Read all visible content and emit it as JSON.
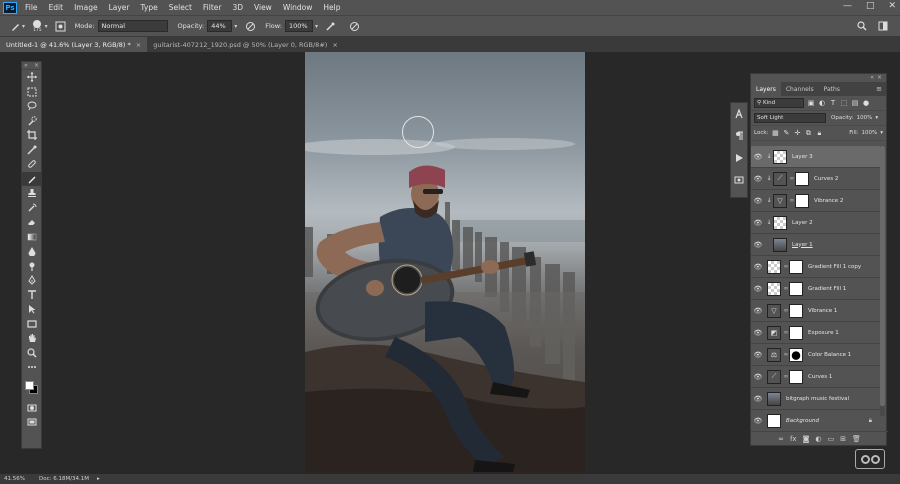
{
  "app": {
    "logo": "Ps"
  },
  "menu": [
    "File",
    "Edit",
    "Image",
    "Layer",
    "Type",
    "Select",
    "Filter",
    "3D",
    "View",
    "Window",
    "Help"
  ],
  "window_controls": {
    "minimize": "—",
    "maximize": "□",
    "close": "✕"
  },
  "options": {
    "brush_size": "175",
    "mode_label": "Mode:",
    "mode_value": "Normal",
    "opacity_label": "Opacity:",
    "opacity_value": "44%",
    "flow_label": "Flow:",
    "flow_value": "100%"
  },
  "tabs": [
    {
      "label": "Untitled-1 @ 41.6% (Layer 3, RGB/8) *",
      "close": "×"
    },
    {
      "label": "guitarist-407212_1920.psd @ 50% (Layer 0, RGB/8#)",
      "close": "×"
    }
  ],
  "layers_panel": {
    "tabs": [
      "Layers",
      "Channels",
      "Paths"
    ],
    "kind_label": "Kind",
    "blend_mode": "Soft Light",
    "opacity_label": "Opacity:",
    "opacity_value": "100%",
    "lock_label": "Lock:",
    "fill_label": "Fill:",
    "fill_value": "100%",
    "layers": [
      {
        "name": "Layer 3"
      },
      {
        "name": "Curves 2"
      },
      {
        "name": "Vibrance 2"
      },
      {
        "name": "Layer 2"
      },
      {
        "name": "Layer 1"
      },
      {
        "name": "Gradient Fill 1 copy"
      },
      {
        "name": "Gradient Fill 1"
      },
      {
        "name": "Vibrance 1"
      },
      {
        "name": "Exposure 1"
      },
      {
        "name": "Color Balance 1"
      },
      {
        "name": "Curves 1"
      },
      {
        "name": "bitgraph music festival"
      },
      {
        "name": "Background"
      }
    ]
  },
  "status": {
    "zoom": "41.56%",
    "doc": "Doc: 6.18M/34.1M",
    "arrow": "▸"
  },
  "colors": {
    "panel": "#535353",
    "dark": "#282828",
    "selected_layer": "#6a6a6a"
  }
}
